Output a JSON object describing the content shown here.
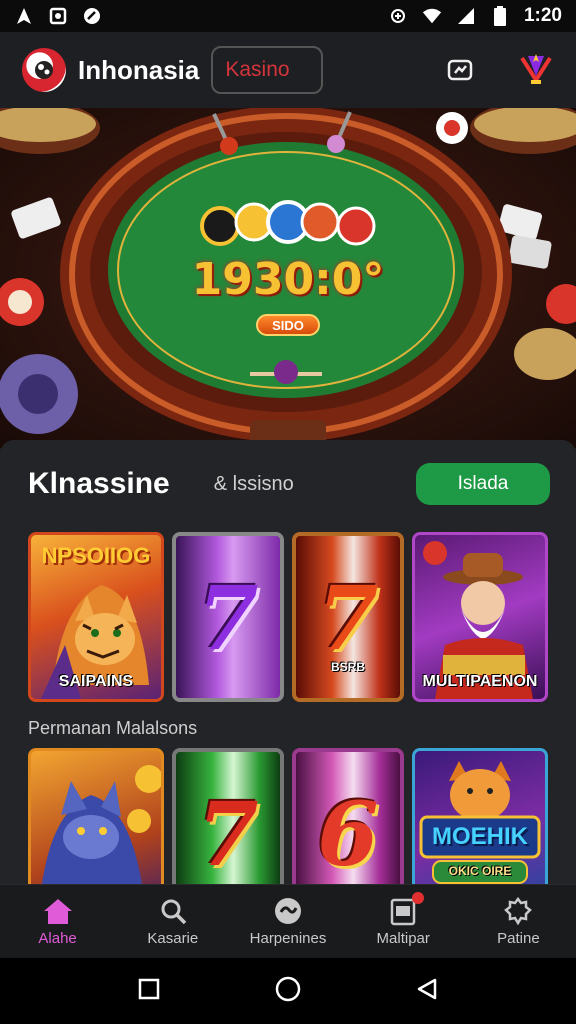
{
  "status_bar": {
    "time": "1:20"
  },
  "header": {
    "app_title": "Inhonasia",
    "category_label": "Kasino"
  },
  "hero": {
    "jackpot": "1930:0°",
    "button_label": "SIDO"
  },
  "section": {
    "title": "Klnassine",
    "subtitle": "& lssisno",
    "action_label": "Islada"
  },
  "row1_tiles": [
    {
      "top_label": "NPSOIIOG",
      "bottom_label": "SAIPAINS",
      "symbol": ""
    },
    {
      "top_label": "",
      "bottom_label": "",
      "symbol": "7"
    },
    {
      "top_label": "",
      "bottom_label": "BSRB",
      "symbol": "7"
    },
    {
      "top_label": "",
      "bottom_label": "MULTIPAENON",
      "symbol": ""
    }
  ],
  "sub_heading": "Permanan Malalsons",
  "row2_tiles": [
    {
      "top_label": "",
      "bottom_label": "",
      "symbol": ""
    },
    {
      "top_label": "",
      "bottom_label": "",
      "symbol": "7"
    },
    {
      "top_label": "",
      "bottom_label": "",
      "symbol": "6"
    },
    {
      "top_label": "MOEHIK",
      "bottom_label": "OKIC OIRE",
      "symbol": ""
    }
  ],
  "bottom_nav": [
    {
      "label": "Alahe",
      "icon": "home-icon"
    },
    {
      "label": "Kasarie",
      "icon": "search-icon"
    },
    {
      "label": "Harpenines",
      "icon": "chip-icon"
    },
    {
      "label": "Maltipar",
      "icon": "clipboard-icon"
    },
    {
      "label": "Patine",
      "icon": "settings-icon"
    }
  ],
  "colors": {
    "accent_active": "#e05bd8",
    "green_button": "#1e9a46",
    "kasino_text": "#d4343a",
    "felt": "#1f7a32"
  }
}
